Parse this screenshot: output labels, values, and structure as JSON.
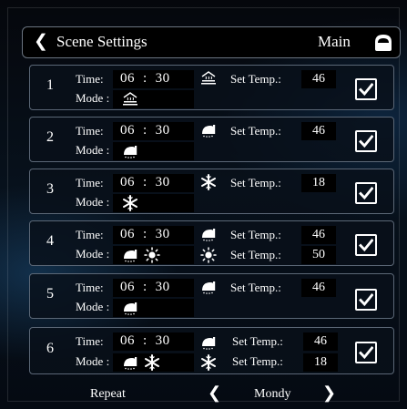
{
  "header": {
    "title": "Scene Settings",
    "main_label": "Main"
  },
  "labels": {
    "time": "Time:",
    "mode": "Mode :",
    "set_temp": "Set Temp.:"
  },
  "scenes": [
    {
      "num": "1",
      "hour": "06",
      "minute": "30",
      "temp1": "46"
    },
    {
      "num": "2",
      "hour": "06",
      "minute": "30",
      "temp1": "46"
    },
    {
      "num": "3",
      "hour": "06",
      "minute": "30",
      "temp1": "18"
    },
    {
      "num": "4",
      "hour": "06",
      "minute": "30",
      "temp1": "46",
      "temp2": "50"
    },
    {
      "num": "5",
      "hour": "06",
      "minute": "30",
      "temp1": "46"
    },
    {
      "num": "6",
      "hour": "06",
      "minute": "30",
      "temp1": "46",
      "temp2": "18"
    }
  ],
  "footer": {
    "repeat": "Repeat",
    "day": "Mondy"
  },
  "icons": {
    "back": "chevron-left-icon",
    "main": "home-icon",
    "floor_heating": "floor-heating-icon",
    "shower": "shower-icon",
    "snowflake": "snowflake-icon",
    "sun": "sun-icon",
    "check": "check-icon",
    "prev": "chevron-left-icon",
    "next": "chevron-right-icon"
  },
  "colors": {
    "background": "#05080e",
    "panel_border": "#5b6776",
    "text": "#ffffff"
  }
}
